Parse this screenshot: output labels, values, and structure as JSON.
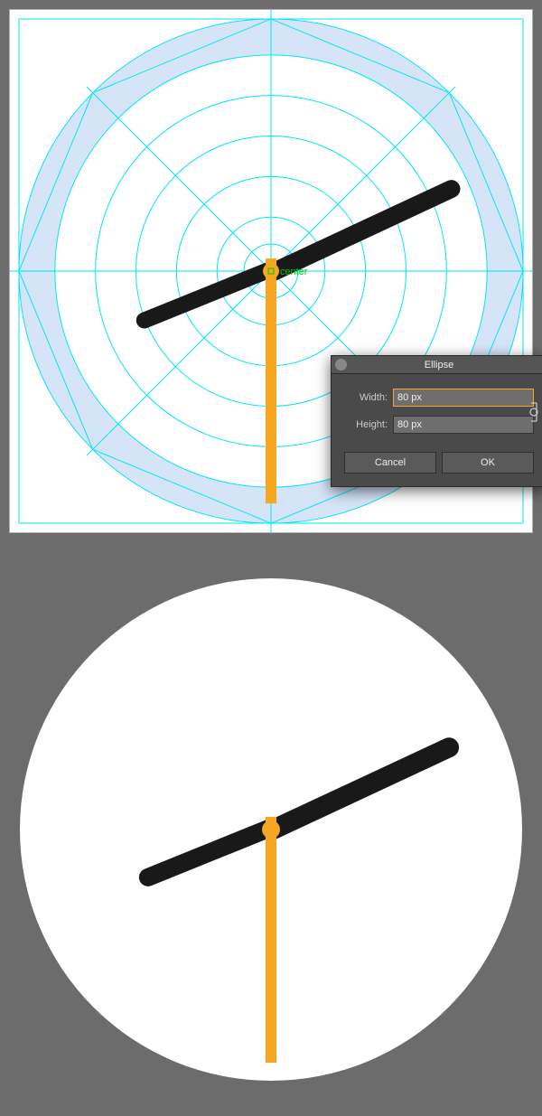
{
  "canvas": {
    "center_label": "center",
    "colors": {
      "guide": "#00e5ff",
      "artboard_bg": "#ffffff",
      "outer_ring_fill": "#d6e4f7",
      "hand_dark": "#191919",
      "hand_orange": "#f5a623"
    }
  },
  "dialog": {
    "title": "Ellipse",
    "width_label": "Width:",
    "height_label": "Height:",
    "width_value": "80 px",
    "height_value": "80 px",
    "cancel_label": "Cancel",
    "ok_label": "OK"
  }
}
